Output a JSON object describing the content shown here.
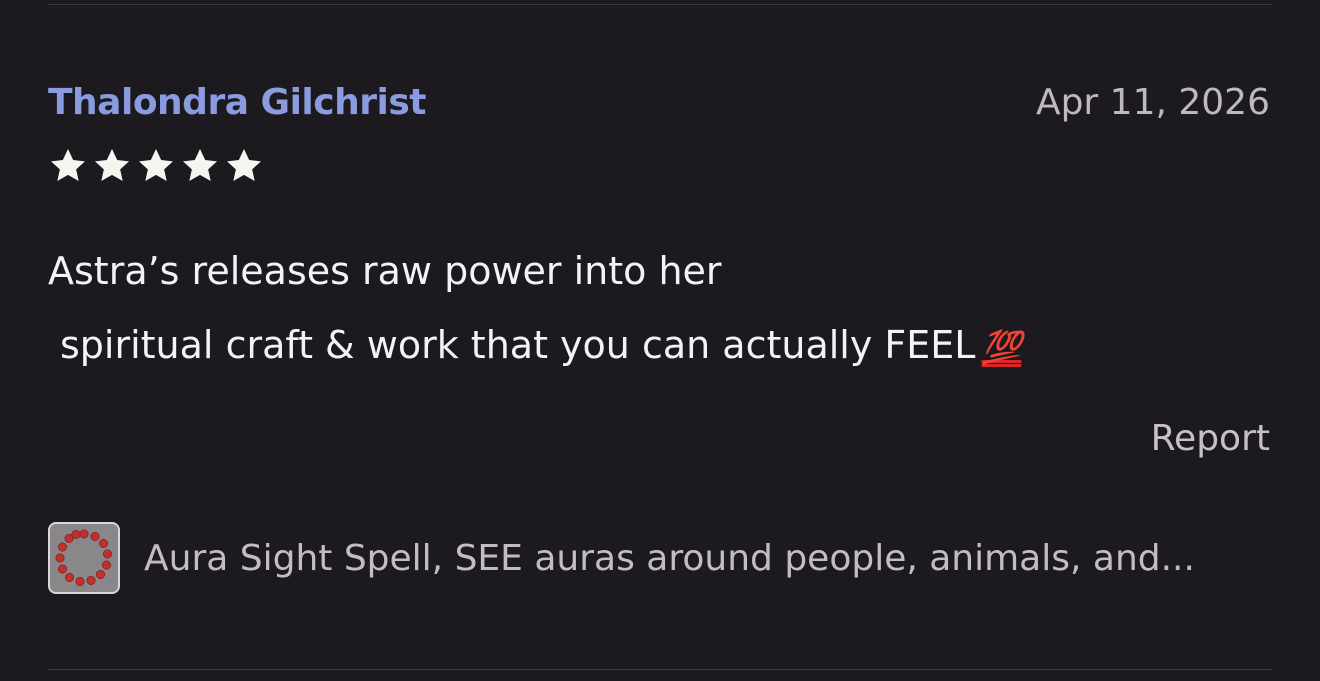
{
  "review": {
    "reviewer_name": "Thalondra Gilchrist",
    "date": "Apr 11, 2026",
    "rating": 5,
    "rating_max": 5,
    "text_line_1": "Astra’s releases raw power into her",
    "text_line_2": "spiritual craft & work that you can actually FEEL",
    "emoji": "💯",
    "report_label": "Report"
  },
  "product": {
    "title": "Aura Sight Spell, SEE auras around people, animals, and...",
    "thumbnail_icon": "red-bead-bracelet"
  },
  "colors": {
    "background": "#1c1a1e",
    "reviewer_name": "#8b9be0",
    "star": "#f7f5f0",
    "text": "#f4f2f5",
    "muted": "#bdb8c2"
  }
}
